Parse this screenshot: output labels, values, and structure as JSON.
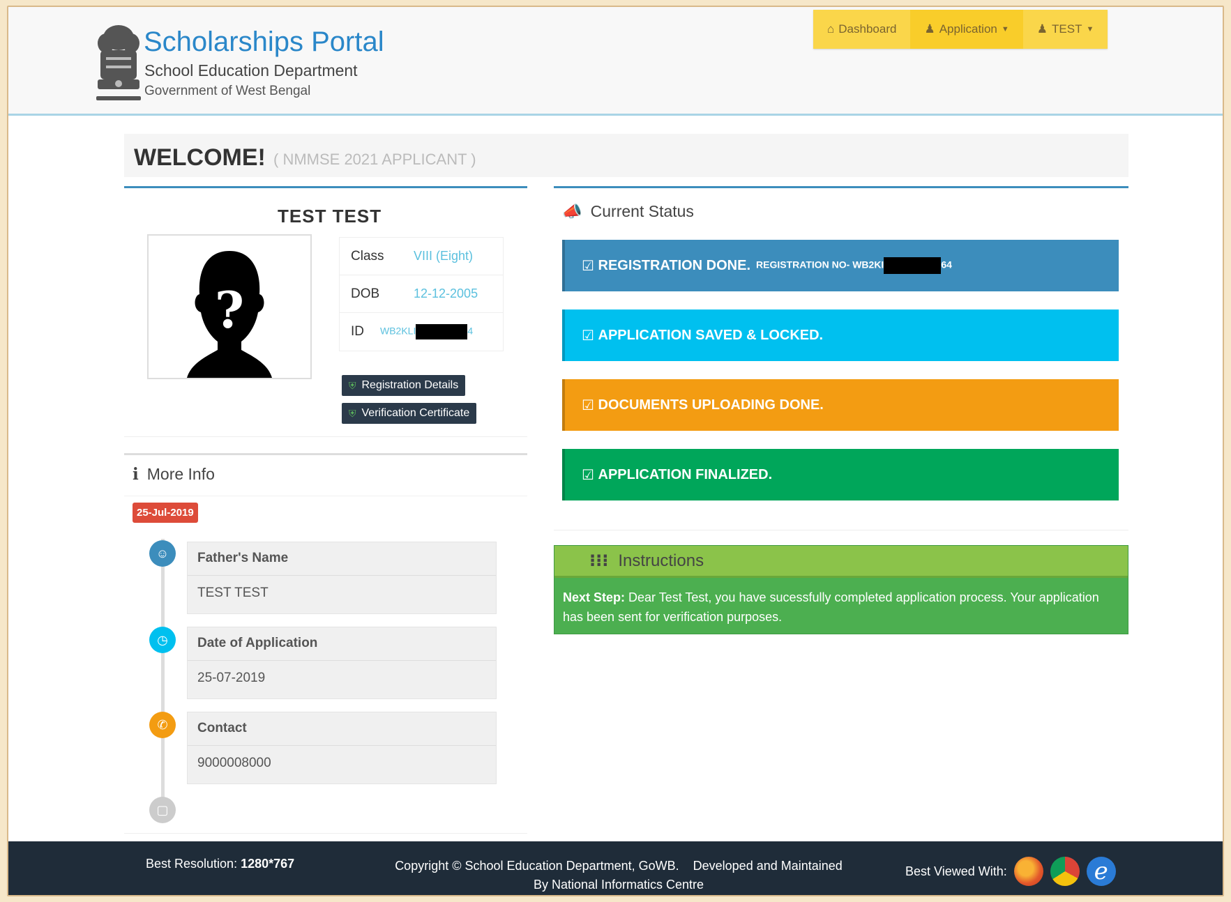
{
  "header": {
    "portal_title": "Scholarships Portal",
    "department": "School Education Department",
    "government": "Government of West Bengal",
    "nav": [
      {
        "label": "Dashboard",
        "icon": "home-icon"
      },
      {
        "label": "Application",
        "icon": "user-icon"
      },
      {
        "label": "TEST",
        "icon": "user-icon"
      }
    ]
  },
  "welcome": {
    "title": "WELCOME!",
    "subtitle": "( NMMSE 2021 APPLICANT )"
  },
  "profile": {
    "name": "TEST TEST",
    "rows": [
      {
        "label": "Class",
        "value": "VIII (Eight)"
      },
      {
        "label": "DOB",
        "value": "12-12-2005"
      },
      {
        "label": "ID",
        "value_prefix": "WB2KLI",
        "value_suffix": "4"
      }
    ],
    "buttons": {
      "registration": "Registration Details",
      "verification": "Verification Certificate"
    }
  },
  "more_info": {
    "title": "More Info",
    "date_badge": "25-Jul-2019",
    "items": [
      {
        "label": "Father's Name",
        "value": "TEST TEST",
        "color": "#3c8dbc"
      },
      {
        "label": "Date of Application",
        "value": "25-07-2019",
        "color": "#00c0ef"
      },
      {
        "label": "Contact",
        "value": "9000008000",
        "color": "#f39c12"
      }
    ]
  },
  "status": {
    "title": "Current Status",
    "alerts": [
      {
        "text": "REGISTRATION DONE.",
        "small_prefix": "REGISTRATION NO- WB2KI",
        "small_suffix": "64",
        "color": "#3c8dbc"
      },
      {
        "text": "APPLICATION SAVED & LOCKED.",
        "color": "#00c0ef"
      },
      {
        "text": "DOCUMENTS UPLOADING DONE.",
        "color": "#f39c12"
      },
      {
        "text": "APPLICATION FINALIZED.",
        "color": "#00a65a"
      }
    ]
  },
  "instructions": {
    "title": "Instructions",
    "next_step_label": "Next Step:",
    "next_step_text": "Dear Test Test, you have sucessfully completed application process. Your application has been sent for verification purposes."
  },
  "footer": {
    "resolution_label": "Best Resolution:",
    "resolution_value": "1280*767",
    "copyright_line1": "Copyright © School Education Department, GoWB.    Developed and Maintained",
    "copyright_line2": "By National Informatics Centre",
    "best_viewed": "Best Viewed With:"
  }
}
